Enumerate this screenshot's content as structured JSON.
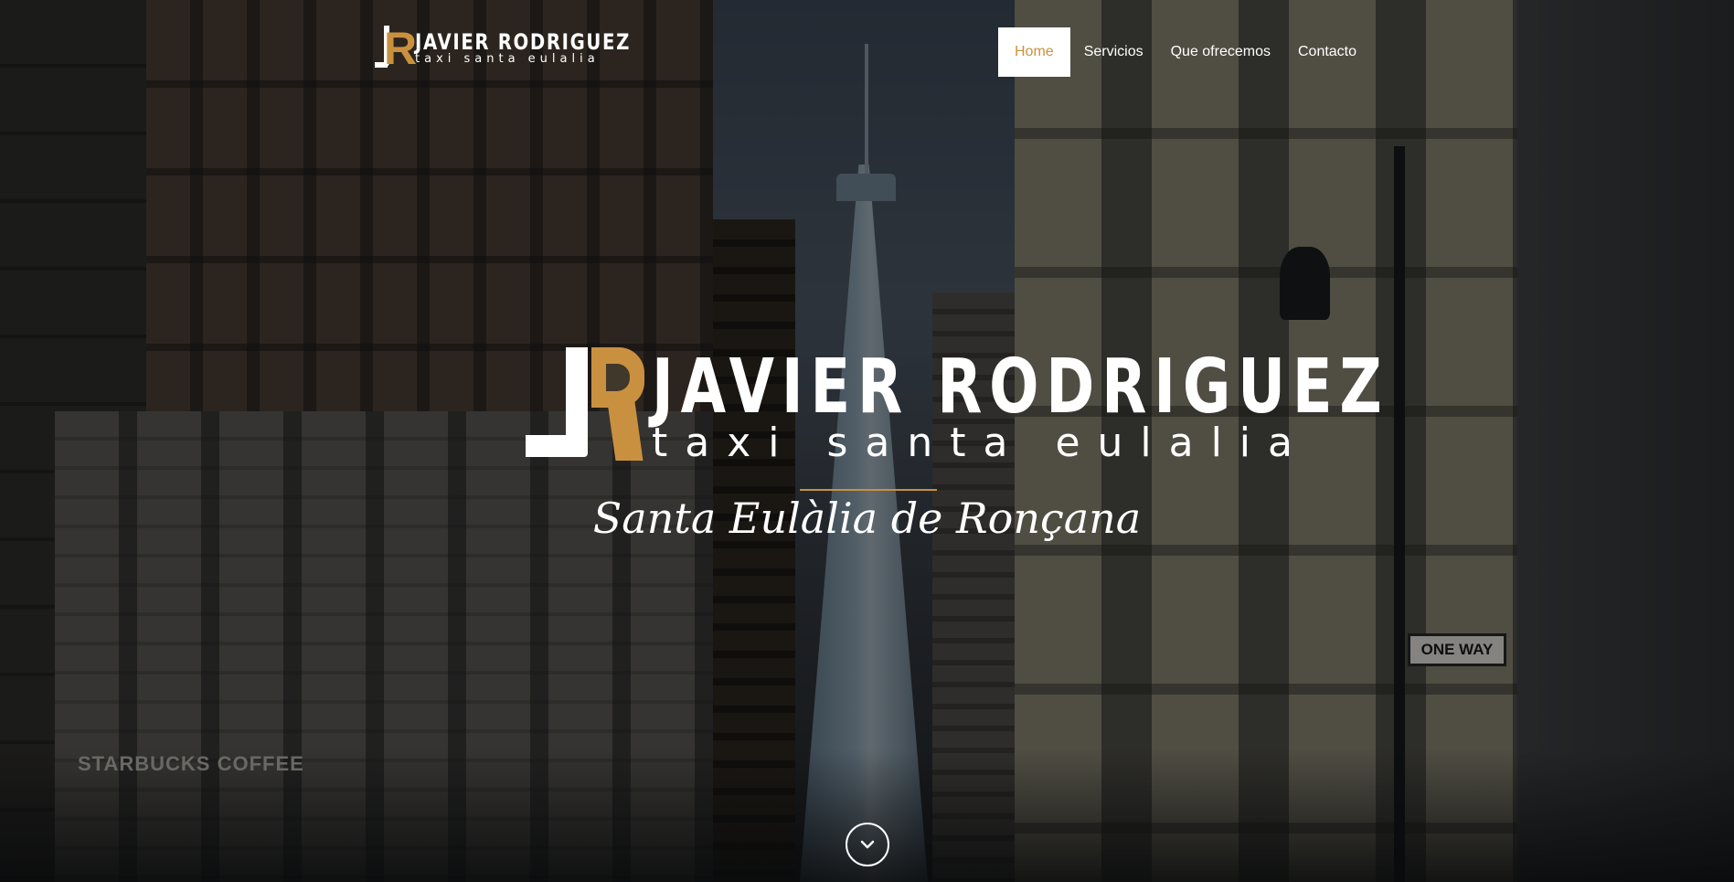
{
  "brand": {
    "name": "JAVIER RODRIGUEZ",
    "subtitle": "taxi santa eulalia",
    "logo_letters": "JR",
    "accent_color": "#c9913f"
  },
  "nav": {
    "items": [
      {
        "label": "Home",
        "active": true
      },
      {
        "label": "Servicios",
        "active": false
      },
      {
        "label": "Que ofrecemos",
        "active": false
      },
      {
        "label": "Contacto",
        "active": false
      }
    ]
  },
  "hero": {
    "name": "JAVIER RODRIGUEZ",
    "subtitle": "taxi santa eulalia",
    "tagline": "Santa Eulàlia de Ronçana",
    "scroll_icon": "chevron-down-icon"
  },
  "background": {
    "store_sign": "STARBUCKS COFFEE",
    "street_sign": "ONE WAY"
  }
}
